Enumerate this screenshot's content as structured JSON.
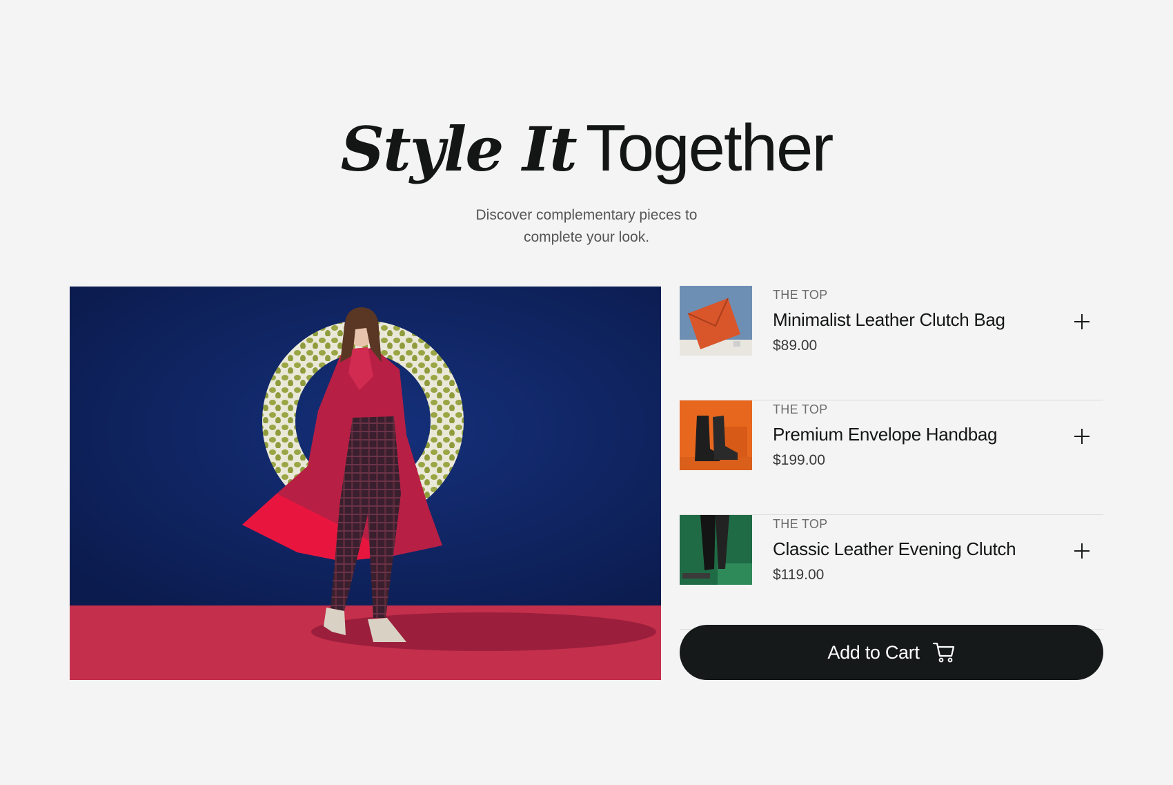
{
  "heading": {
    "italic_part": "Style It",
    "plain_part": "Together"
  },
  "subtitle": {
    "line1": "Discover complementary pieces to",
    "line2": "complete your look."
  },
  "hero": {
    "image_description": "hero-image"
  },
  "products": [
    {
      "brand": "THE TOP",
      "name": "Minimalist Leather Clutch Bag",
      "price": "$89.00",
      "thumb": "clutch-bag-image"
    },
    {
      "brand": "THE TOP",
      "name": "Premium Envelope Handbag",
      "price": "$199.00",
      "thumb": "boots-image"
    },
    {
      "brand": "THE TOP",
      "name": "Classic Leather Evening Clutch",
      "price": "$119.00",
      "thumb": "trousers-image"
    }
  ],
  "cart": {
    "label": "Add to Cart",
    "icon": "cart-icon"
  },
  "colors": {
    "background": "#f4f4f4",
    "button": "#151919",
    "hero_blue": "#0f2360",
    "hero_floor": "#c42f4c"
  }
}
